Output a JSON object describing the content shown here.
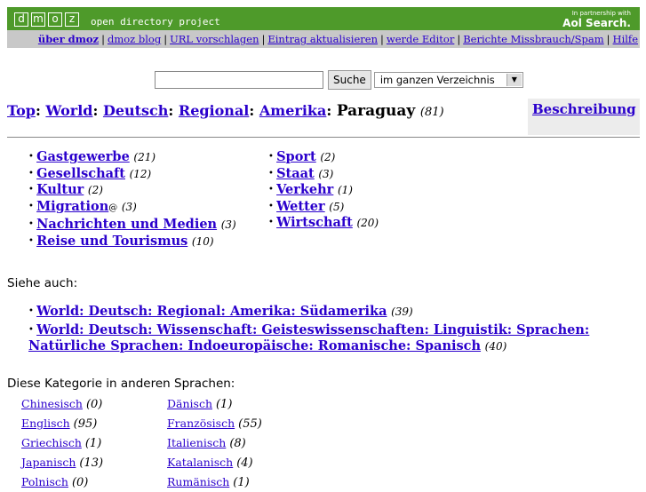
{
  "header": {
    "logo_letters": [
      "d",
      "m",
      "o",
      "z"
    ],
    "tagline": "open directory project",
    "partner_line": "In partnership with",
    "partner_brand": "Aol Search."
  },
  "nav": [
    {
      "label": "über dmoz",
      "bold": true
    },
    {
      "label": "dmoz blog"
    },
    {
      "label": "URL vorschlagen"
    },
    {
      "label": "Eintrag aktualisieren"
    },
    {
      "label": "werde Editor"
    },
    {
      "label": "Berichte Missbrauch/Spam"
    },
    {
      "label": "Hilfe"
    }
  ],
  "search": {
    "value": "",
    "button": "Suche",
    "scope": "im ganzen Verzeichnis"
  },
  "breadcrumb": {
    "items": [
      "Top",
      "World",
      "Deutsch",
      "Regional",
      "Amerika"
    ],
    "current": "Paraguay",
    "count": "(81)"
  },
  "description_link": "Beschreibung",
  "categories": {
    "left": [
      {
        "name": "Gastgewerbe",
        "count": "(21)"
      },
      {
        "name": "Gesellschaft",
        "count": "(12)"
      },
      {
        "name": "Kultur",
        "count": "(2)"
      },
      {
        "name": "Migration",
        "count": "(3)",
        "at": "@"
      },
      {
        "name": "Nachrichten und Medien",
        "count": "(3)"
      },
      {
        "name": "Reise und Tourismus",
        "count": "(10)"
      }
    ],
    "right": [
      {
        "name": "Sport",
        "count": "(2)"
      },
      {
        "name": "Staat",
        "count": "(3)"
      },
      {
        "name": "Verkehr",
        "count": "(1)"
      },
      {
        "name": "Wetter",
        "count": "(5)"
      },
      {
        "name": "Wirtschaft",
        "count": "(20)"
      }
    ]
  },
  "see_also_label": "Siehe auch:",
  "see_also": [
    {
      "name": "World: Deutsch: Regional: Amerika: Südamerika",
      "count": "(39)"
    },
    {
      "name": "World: Deutsch: Wissenschaft: Geisteswissenschaften: Linguistik: Sprachen: Natürliche Sprachen: Indoeuropäische: Romanische: Spanisch",
      "count": "(40)"
    }
  ],
  "languages_label": "Diese Kategorie in anderen Sprachen:",
  "languages": {
    "left": [
      {
        "name": "Chinesisch",
        "count": "(0)"
      },
      {
        "name": "Englisch",
        "count": "(95)"
      },
      {
        "name": "Griechisch",
        "count": "(1)"
      },
      {
        "name": "Japanisch",
        "count": "(13)"
      },
      {
        "name": "Polnisch",
        "count": "(0)"
      }
    ],
    "right": [
      {
        "name": "Dänisch",
        "count": "(1)"
      },
      {
        "name": "Französisch",
        "count": "(55)"
      },
      {
        "name": "Italienisch",
        "count": "(8)"
      },
      {
        "name": "Katalanisch",
        "count": "(4)"
      },
      {
        "name": "Rumänisch",
        "count": "(1)"
      }
    ]
  }
}
